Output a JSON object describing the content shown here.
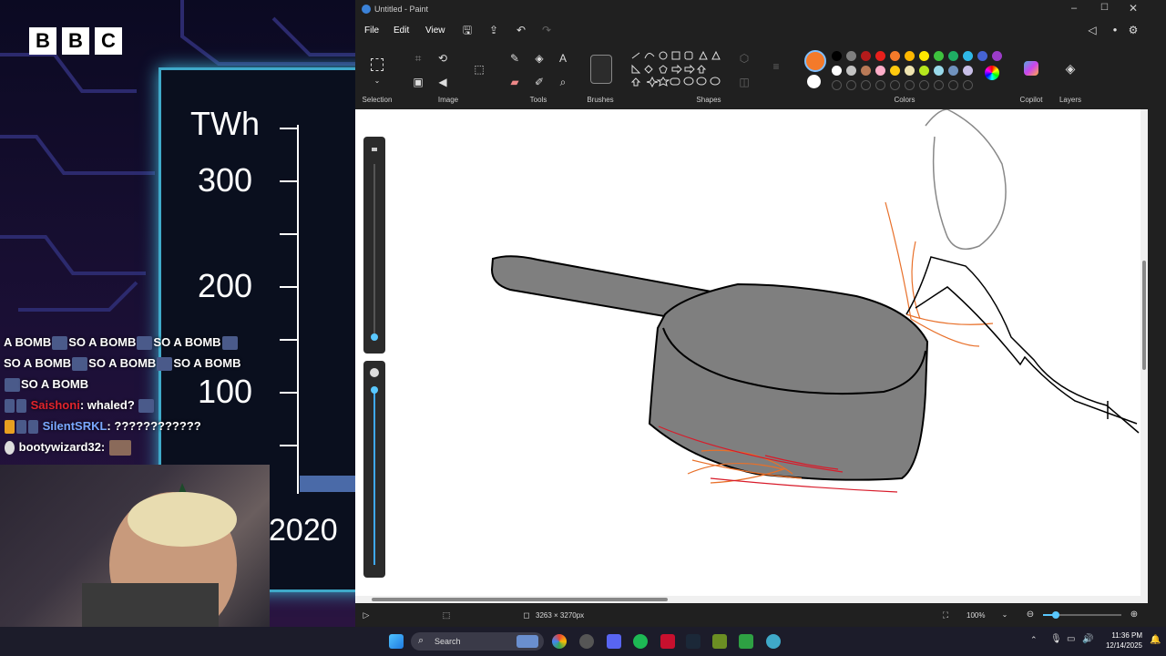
{
  "stream": {
    "logo_letters": [
      "B",
      "B",
      "C"
    ],
    "chart": {
      "unit": "TWh",
      "ticks": [
        "300",
        "200",
        "100"
      ],
      "year": "2020"
    },
    "chat": [
      {
        "text": "A BOMB",
        "emote": true
      },
      {
        "text": "SO A BOMB",
        "emote": true
      },
      {
        "text": "SO A BOMB",
        "emote": true
      },
      {
        "text": "SO A BOMB",
        "emote": true
      },
      {
        "text": "SO A BOMB",
        "emote": true
      },
      {
        "text": "SO A BOMB",
        "emote": true
      },
      {
        "text": "SO A BOMB",
        "emote": true
      }
    ],
    "chat_users": [
      {
        "user": "Saishoni",
        "message": "whaled?",
        "color": "#e0242c"
      },
      {
        "user": "SilentSRKL",
        "message": "????????????",
        "color": "#7aa8ff"
      },
      {
        "user": "bootywizard32",
        "message": "",
        "color": "#ffffff"
      }
    ]
  },
  "paint": {
    "title": "Untitled - Paint",
    "menu": {
      "file": "File",
      "edit": "Edit",
      "view": "View"
    },
    "groups": {
      "selection": "Selection",
      "image": "Image",
      "tools": "Tools",
      "brushes": "Brushes",
      "shapes": "Shapes",
      "colors": "Colors",
      "copilot": "Copilot",
      "layers": "Layers"
    },
    "active_color": "#f47a2a",
    "secondary_color": "#ffffff",
    "palette_row1": [
      "#000000",
      "#7f7f7f",
      "#b31b1b",
      "#e8201c",
      "#f47a2a",
      "#ffb700",
      "#ffe800",
      "#3ec23e",
      "#1fae64",
      "#2fb8e8",
      "#4563d3",
      "#9b3cc8"
    ],
    "palette_row2": [
      "#ffffff",
      "#c3c3c3",
      "#b97a57",
      "#ffaec9",
      "#ffc90e",
      "#efe4b0",
      "#b5e61d",
      "#99d9ea",
      "#7092be",
      "#c8bfe7"
    ],
    "status": {
      "canvas_size": "3263 × 3270px",
      "zoom": "100%"
    }
  },
  "taskbar": {
    "search_placeholder": "Search",
    "time": "11:36 PM",
    "date": "12/14/2025"
  }
}
